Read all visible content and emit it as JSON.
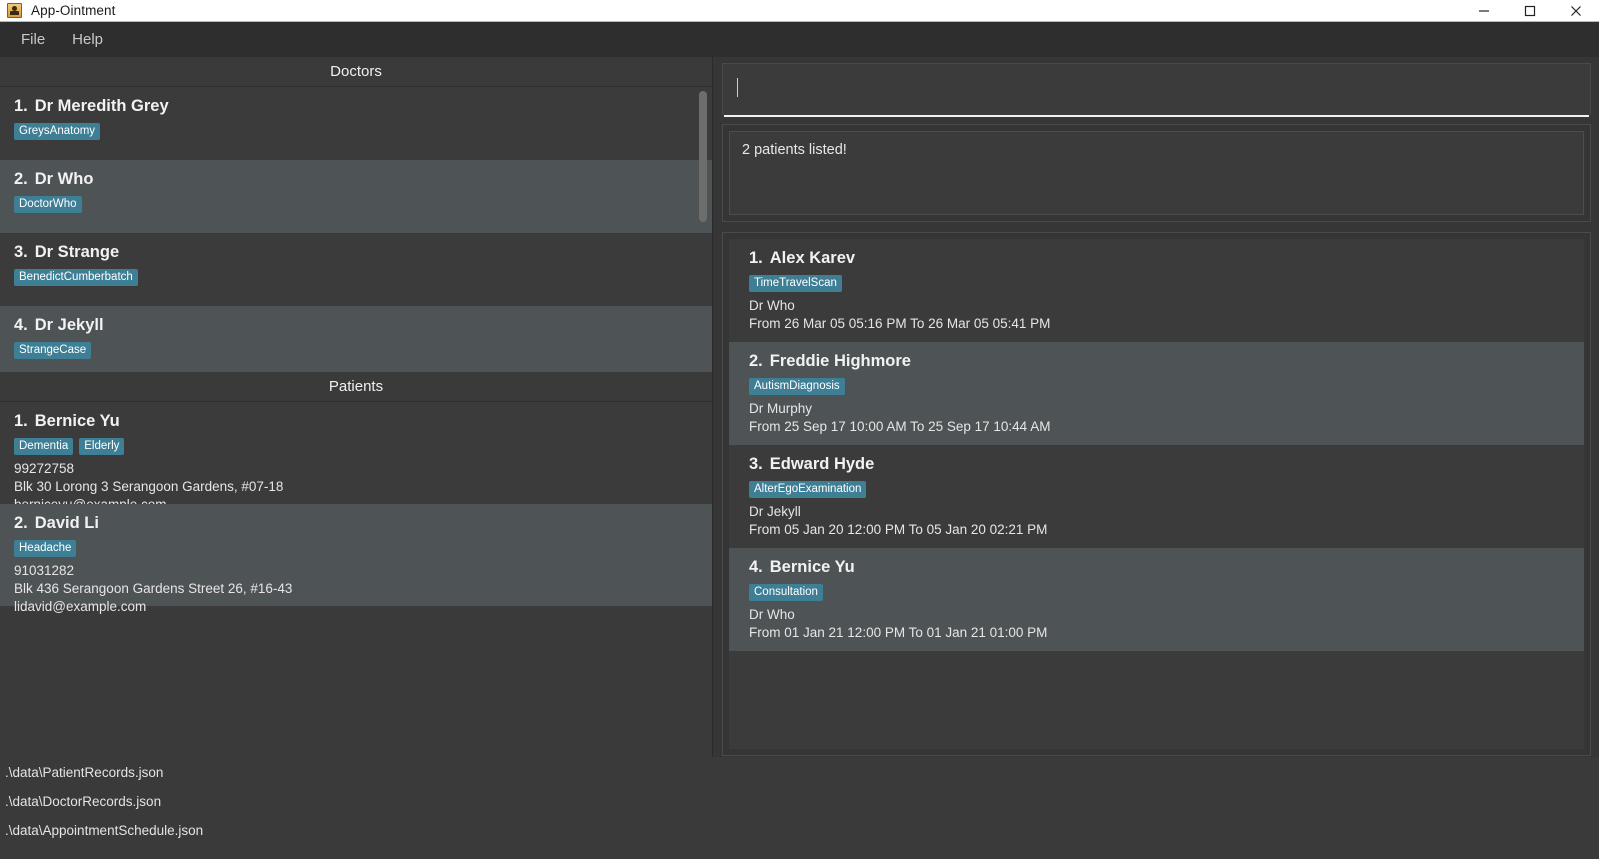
{
  "window": {
    "title": "App-Ointment",
    "icon": "app-icon",
    "minimize_label": "–",
    "maximize_label": "□",
    "close_label": "✕"
  },
  "menubar": {
    "items": [
      {
        "label": "File"
      },
      {
        "label": "Help"
      }
    ]
  },
  "doctors_panel": {
    "header": "Doctors",
    "items": [
      {
        "index": "1.",
        "name": "Dr Meredith Grey",
        "tags": [
          "GreysAnatomy"
        ]
      },
      {
        "index": "2.",
        "name": "Dr Who",
        "tags": [
          "DoctorWho"
        ]
      },
      {
        "index": "3.",
        "name": "Dr Strange",
        "tags": [
          "BenedictCumberbatch"
        ]
      },
      {
        "index": "4.",
        "name": "Dr Jekyll",
        "tags": [
          "StrangeCase"
        ]
      }
    ]
  },
  "patients_panel": {
    "header": "Patients",
    "items": [
      {
        "index": "1.",
        "name": "Bernice Yu",
        "tags": [
          "Dementia",
          "Elderly"
        ],
        "phone": "99272758",
        "address": "Blk 30 Lorong 3 Serangoon Gardens, #07-18",
        "email": "berniceyu@example.com"
      },
      {
        "index": "2.",
        "name": "David Li",
        "tags": [
          "Headache"
        ],
        "phone": "91031282",
        "address": "Blk 436 Serangoon Gardens Street 26, #16-43",
        "email": "lidavid@example.com"
      }
    ]
  },
  "command": {
    "value": "",
    "placeholder": ""
  },
  "result": {
    "message": "2 patients listed!"
  },
  "appointments_panel": {
    "items": [
      {
        "index": "1.",
        "patient": "Alex Karev",
        "tags": [
          "TimeTravelScan"
        ],
        "doctor": "Dr Who",
        "period": "From 26 Mar 05 05:16 PM To 26 Mar 05 05:41 PM"
      },
      {
        "index": "2.",
        "patient": "Freddie Highmore",
        "tags": [
          "AutismDiagnosis"
        ],
        "doctor": "Dr Murphy",
        "period": "From 25 Sep 17 10:00 AM To 25 Sep 17 10:44 AM"
      },
      {
        "index": "3.",
        "patient": "Edward Hyde",
        "tags": [
          "AlterEgoExamination"
        ],
        "doctor": "Dr Jekyll",
        "period": "From 05 Jan 20 12:00 PM To 05 Jan 20 02:21 PM"
      },
      {
        "index": "4.",
        "patient": "Bernice Yu",
        "tags": [
          "Consultation"
        ],
        "doctor": "Dr Who",
        "period": "From 01 Jan 21 12:00 PM To 01 Jan 21 01:00 PM"
      }
    ]
  },
  "footer": {
    "paths": [
      ".\\data\\PatientRecords.json",
      ".\\data\\DoctorRecords.json",
      ".\\data\\AppointmentSchedule.json"
    ]
  },
  "colors": {
    "tag_background": "#3e7f96",
    "window_background": "#363636",
    "card_background": "#3b3b3b",
    "card_alt_background": "#4e5356",
    "accent_underline": "#f2f2f2"
  }
}
